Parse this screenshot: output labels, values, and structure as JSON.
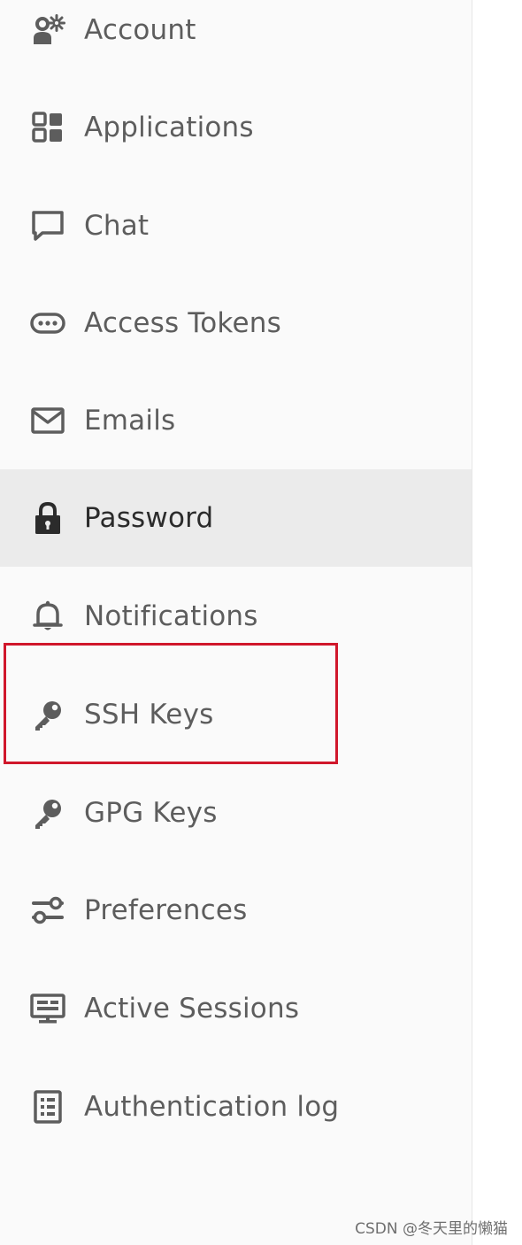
{
  "sidebar": {
    "items": [
      {
        "label": "Account",
        "icon": "account-settings-icon"
      },
      {
        "label": "Applications",
        "icon": "applications-grid-icon"
      },
      {
        "label": "Chat",
        "icon": "chat-bubble-icon"
      },
      {
        "label": "Access Tokens",
        "icon": "token-icon"
      },
      {
        "label": "Emails",
        "icon": "envelope-icon"
      },
      {
        "label": "Password",
        "icon": "lock-icon",
        "active": true
      },
      {
        "label": "Notifications",
        "icon": "bell-icon"
      },
      {
        "label": "SSH Keys",
        "icon": "key-icon",
        "highlighted": true
      },
      {
        "label": "GPG Keys",
        "icon": "key-icon"
      },
      {
        "label": "Preferences",
        "icon": "preferences-sliders-icon"
      },
      {
        "label": "Active Sessions",
        "icon": "monitor-icon"
      },
      {
        "label": "Authentication log",
        "icon": "log-list-icon"
      }
    ]
  },
  "colors": {
    "sidebar_background": "#fafafa",
    "active_background": "#ebebeb",
    "label_text": "#5d5d5d",
    "active_label_text": "#2b2b2b",
    "icon": "#5d5d5d",
    "highlight_border": "#d0172b"
  },
  "watermark": "CSDN @冬天里的懒猫"
}
